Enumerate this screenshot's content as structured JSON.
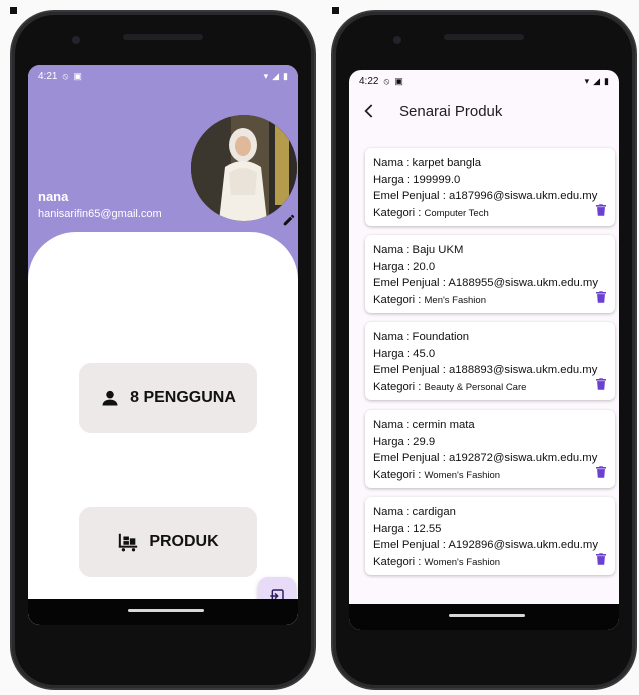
{
  "left_phone": {
    "status_time": "4:21",
    "profile": {
      "name": "nana",
      "email": "hanisarifin65@gmail.com"
    },
    "users_button": {
      "label": "8 PENGGUNA"
    },
    "products_button": {
      "label": "PRODUK"
    },
    "colors": {
      "header": "#9c8fd6",
      "fab": "#e7dbf7"
    }
  },
  "right_phone": {
    "status_time": "4:22",
    "title": "Senarai Produk",
    "products": [
      {
        "nama": "Nama : karpet bangla",
        "harga": "Harga : 199999.0",
        "emel": "Emel Penjual : a187996@siswa.ukm.edu.my",
        "kategori_label": "Kategori :",
        "kategori": "Computer Tech"
      },
      {
        "nama": "Nama : Baju UKM",
        "harga": "Harga : 20.0",
        "emel": "Emel Penjual : A188955@siswa.ukm.edu.my",
        "kategori_label": "Kategori :",
        "kategori": "Men's Fashion"
      },
      {
        "nama": "Nama : Foundation",
        "harga": "Harga : 45.0",
        "emel": "Emel Penjual : a188893@siswa.ukm.edu.my",
        "kategori_label": "Kategori :",
        "kategori": "Beauty & Personal Care"
      },
      {
        "nama": "Nama : cermin mata",
        "harga": "Harga : 29.9",
        "emel": "Emel Penjual : a192872@siswa.ukm.edu.my",
        "kategori_label": "Kategori :",
        "kategori": "Women's Fashion"
      },
      {
        "nama": "Nama : cardigan",
        "harga": "Harga : 12.55",
        "emel": "Emel Penjual : A192896@siswa.ukm.edu.my",
        "kategori_label": "Kategori :",
        "kategori": "Women's Fashion"
      }
    ],
    "colors": {
      "trash": "#6a3fd1",
      "background": "#fcf8fd"
    }
  }
}
